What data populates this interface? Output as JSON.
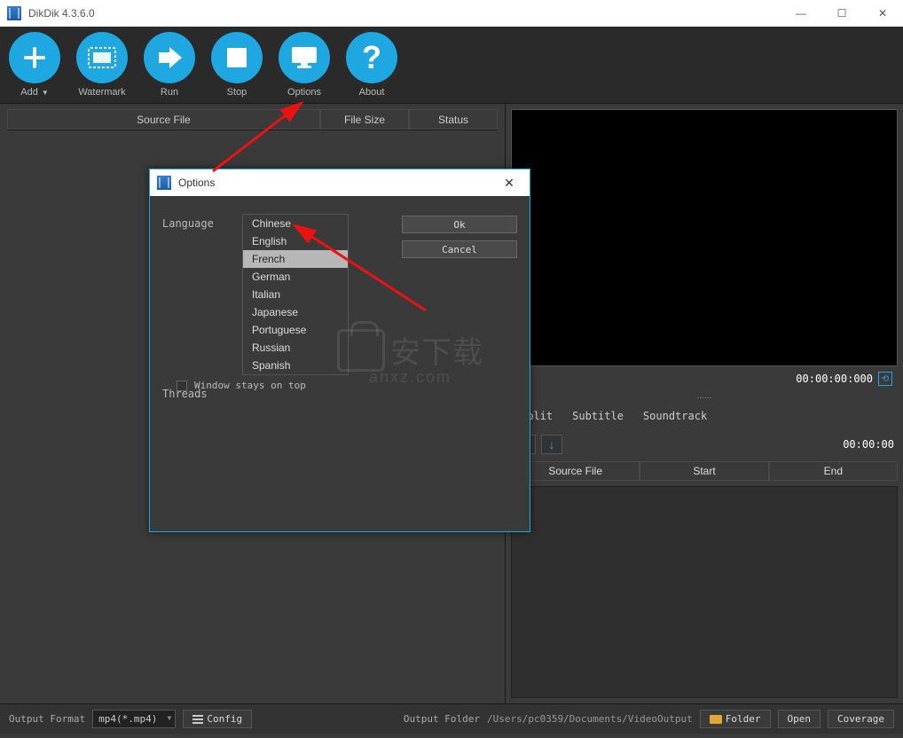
{
  "titlebar": {
    "title": "DikDik 4.3.6.0"
  },
  "toolbar": {
    "add": "Add",
    "watermark": "Watermark",
    "run": "Run",
    "stop": "Stop",
    "options": "Options",
    "about": "About"
  },
  "table": {
    "source_file": "Source File",
    "file_size": "File Size",
    "status": "Status"
  },
  "preview": {
    "time": "00:00:00:000",
    "clock": "00:00:00",
    "dots": "......"
  },
  "tabs": {
    "split": "Split",
    "subtitle": "Subtitle",
    "soundtrack": "Soundtrack"
  },
  "subtable": {
    "source_file": "Source File",
    "start": "Start",
    "end": "End"
  },
  "bottom": {
    "output_format_label": "Output Format",
    "output_format_value": "mp4(*.mp4)",
    "config": "Config",
    "output_folder_label": "Output Folder",
    "output_folder_path": "/Users/pc0359/Documents/VideoOutput",
    "folder_btn": "Folder",
    "open_btn": "Open",
    "coverage_btn": "Coverage"
  },
  "dialog": {
    "title": "Options",
    "language_label": "Language",
    "threads_label": "Threads",
    "ok": "Ok",
    "cancel": "Cancel",
    "stay_on_top": "Window stays on top",
    "languages": [
      "Chinese",
      "English",
      "French",
      "German",
      "Italian",
      "Japanese",
      "Portuguese",
      "Russian",
      "Spanish"
    ],
    "hovered": "French"
  },
  "watermark": {
    "main": "安下载",
    "sub": "anxz.com"
  }
}
